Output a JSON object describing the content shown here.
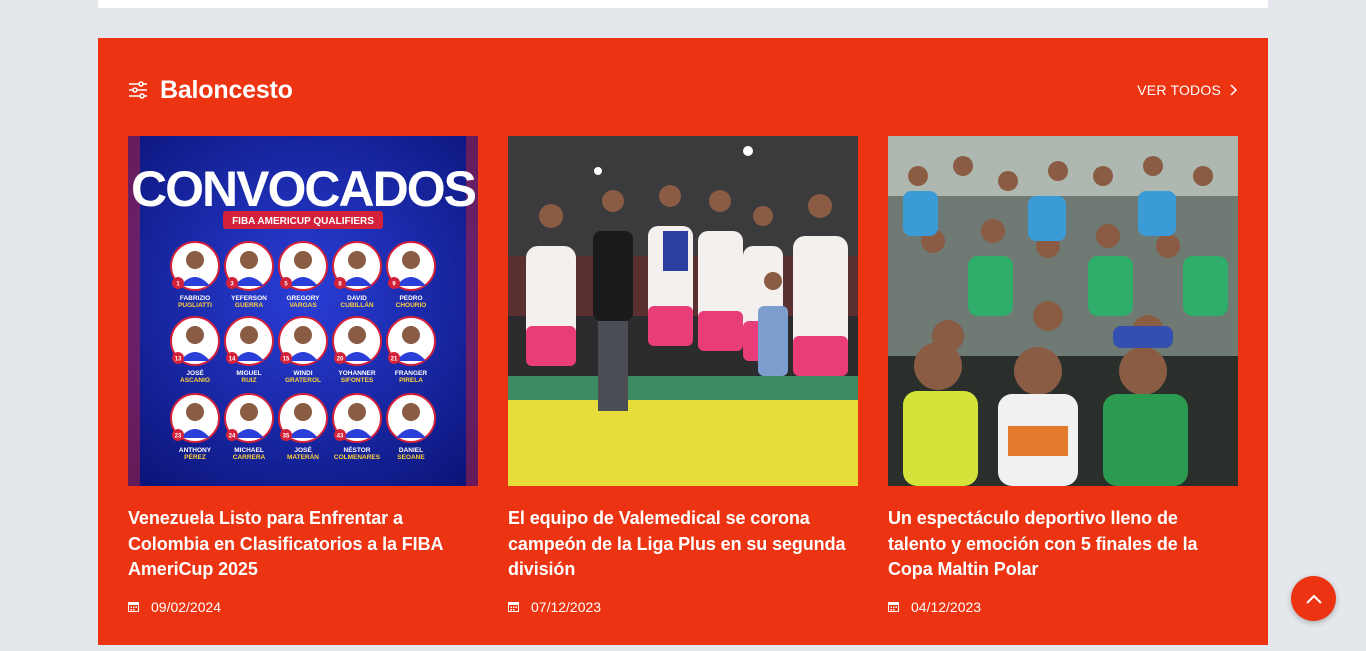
{
  "section": {
    "title": "Baloncesto",
    "view_all_label": "VER TODOS",
    "accent_color": "#ec3412"
  },
  "articles": [
    {
      "title": "Venezuela Listo para Enfrentar a Colombia en Clasificatorios a la FIBA AmeriCup 2025",
      "date": "09/02/2024",
      "image": {
        "headline": "CONVOCADOS",
        "banner": "FIBA AMERICUP QUALIFIERS",
        "players": [
          {
            "num": "1",
            "name": "FABRIZIO",
            "surname": "PUGLIATTI"
          },
          {
            "num": "3",
            "name": "YEFERSON",
            "surname": "GUERRA"
          },
          {
            "num": "5",
            "name": "GREGORY",
            "surname": "VARGAS"
          },
          {
            "num": "8",
            "name": "DAVID",
            "surname": "CUBILLÁN"
          },
          {
            "num": "9",
            "name": "PEDRO",
            "surname": "CHOURIO"
          },
          {
            "num": "13",
            "name": "JOSÉ",
            "surname": "ASCANIO"
          },
          {
            "num": "14",
            "name": "MIGUEL",
            "surname": "RUIZ"
          },
          {
            "num": "15",
            "name": "WINDI",
            "surname": "GRATEROL"
          },
          {
            "num": "20",
            "name": "YOHANNER",
            "surname": "SIFONTES"
          },
          {
            "num": "21",
            "name": "FRANGER",
            "surname": "PIRELA"
          },
          {
            "num": "23",
            "name": "ANTHONY",
            "surname": "PÉREZ"
          },
          {
            "num": "24",
            "name": "MICHAEL",
            "surname": "CARRERA"
          },
          {
            "num": "35",
            "name": "JOSÉ",
            "surname": "MATERÁN"
          },
          {
            "num": "43",
            "name": "NÉSTOR",
            "surname": "COLMENARES"
          },
          {
            "num": "",
            "name": "DANIEL",
            "surname": "SEOANE"
          }
        ]
      }
    },
    {
      "title": "El equipo de Valemedical se corona campeón de la Liga Plus en su segunda división",
      "date": "07/12/2023",
      "image": {}
    },
    {
      "title": "Un espectáculo deportivo lleno de talento y emoción con 5 finales de la Copa Maltin Polar",
      "date": "04/12/2023",
      "image": {}
    }
  ]
}
